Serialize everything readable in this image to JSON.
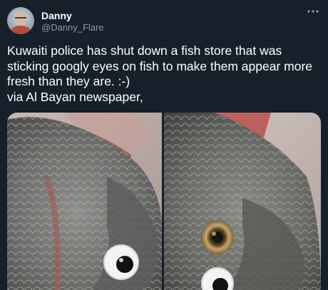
{
  "user": {
    "name": "Danny",
    "handle": "@Danny_Flare",
    "more_icon": "more-horizontal-icon"
  },
  "tweet": {
    "lines": [
      "Kuwaiti police has shut down a fish store that was",
      "sticking googly eyes on fish to make them appear more",
      "fresh than they are. :-)",
      "via Al Bayan newspaper,"
    ]
  },
  "media": {
    "images": [
      "fish-with-googly-eye-photo",
      "fish-with-real-eye-photo"
    ]
  },
  "colors": {
    "background": "#15202b",
    "text": "#ffffff",
    "secondary_text": "#8b98a5"
  }
}
